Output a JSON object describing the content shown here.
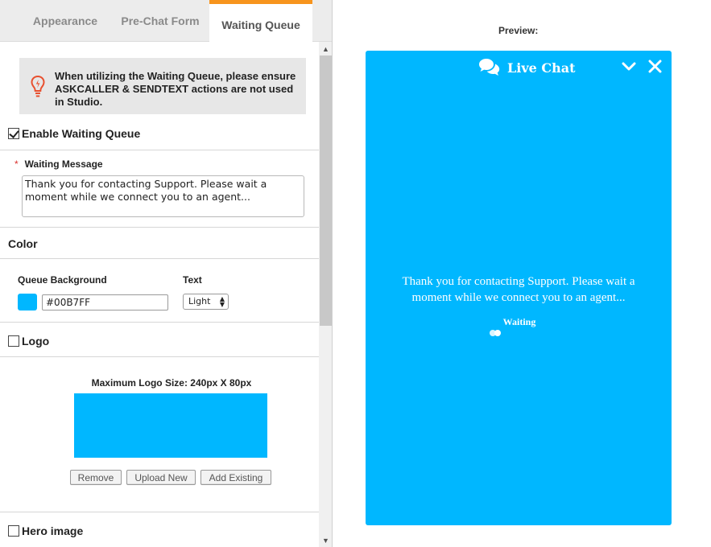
{
  "tabs": [
    {
      "label": "Appearance",
      "active": false
    },
    {
      "label": "Pre-Chat Form",
      "active": false
    },
    {
      "label": "Waiting Queue",
      "active": true
    }
  ],
  "notice": {
    "text": "When utilizing the Waiting Queue, please ensure ASKCALLER & SENDTEXT actions are not used in Studio.",
    "icon": "lightbulb-icon"
  },
  "enable_queue": {
    "label": "Enable Waiting Queue",
    "checked": true
  },
  "waiting_message": {
    "required_mark": "*",
    "label": "Waiting Message",
    "value": "Thank you for contacting Support. Please wait a moment while we connect you to an agent..."
  },
  "color": {
    "title": "Color",
    "queue_bg_label": "Queue Background",
    "queue_bg_value": "#00B7FF",
    "text_label": "Text",
    "text_value": "Light"
  },
  "logo": {
    "label": "Logo",
    "checked": false,
    "max_size": "Maximum Logo Size: 240px X 80px",
    "buttons": {
      "remove": "Remove",
      "upload": "Upload New",
      "existing": "Add Existing"
    }
  },
  "hero": {
    "label": "Hero image",
    "checked": false
  },
  "preview": {
    "label": "Preview:",
    "chat_title": "Live Chat",
    "message": "Thank you for contacting Support. Please wait a moment while we connect you to an agent...",
    "waiting": "Waiting"
  },
  "colors": {
    "accent_tab": "#f7941d",
    "queue_bg": "#00B7FF",
    "notice_icon": "#e8502f",
    "required": "#d9302c"
  }
}
